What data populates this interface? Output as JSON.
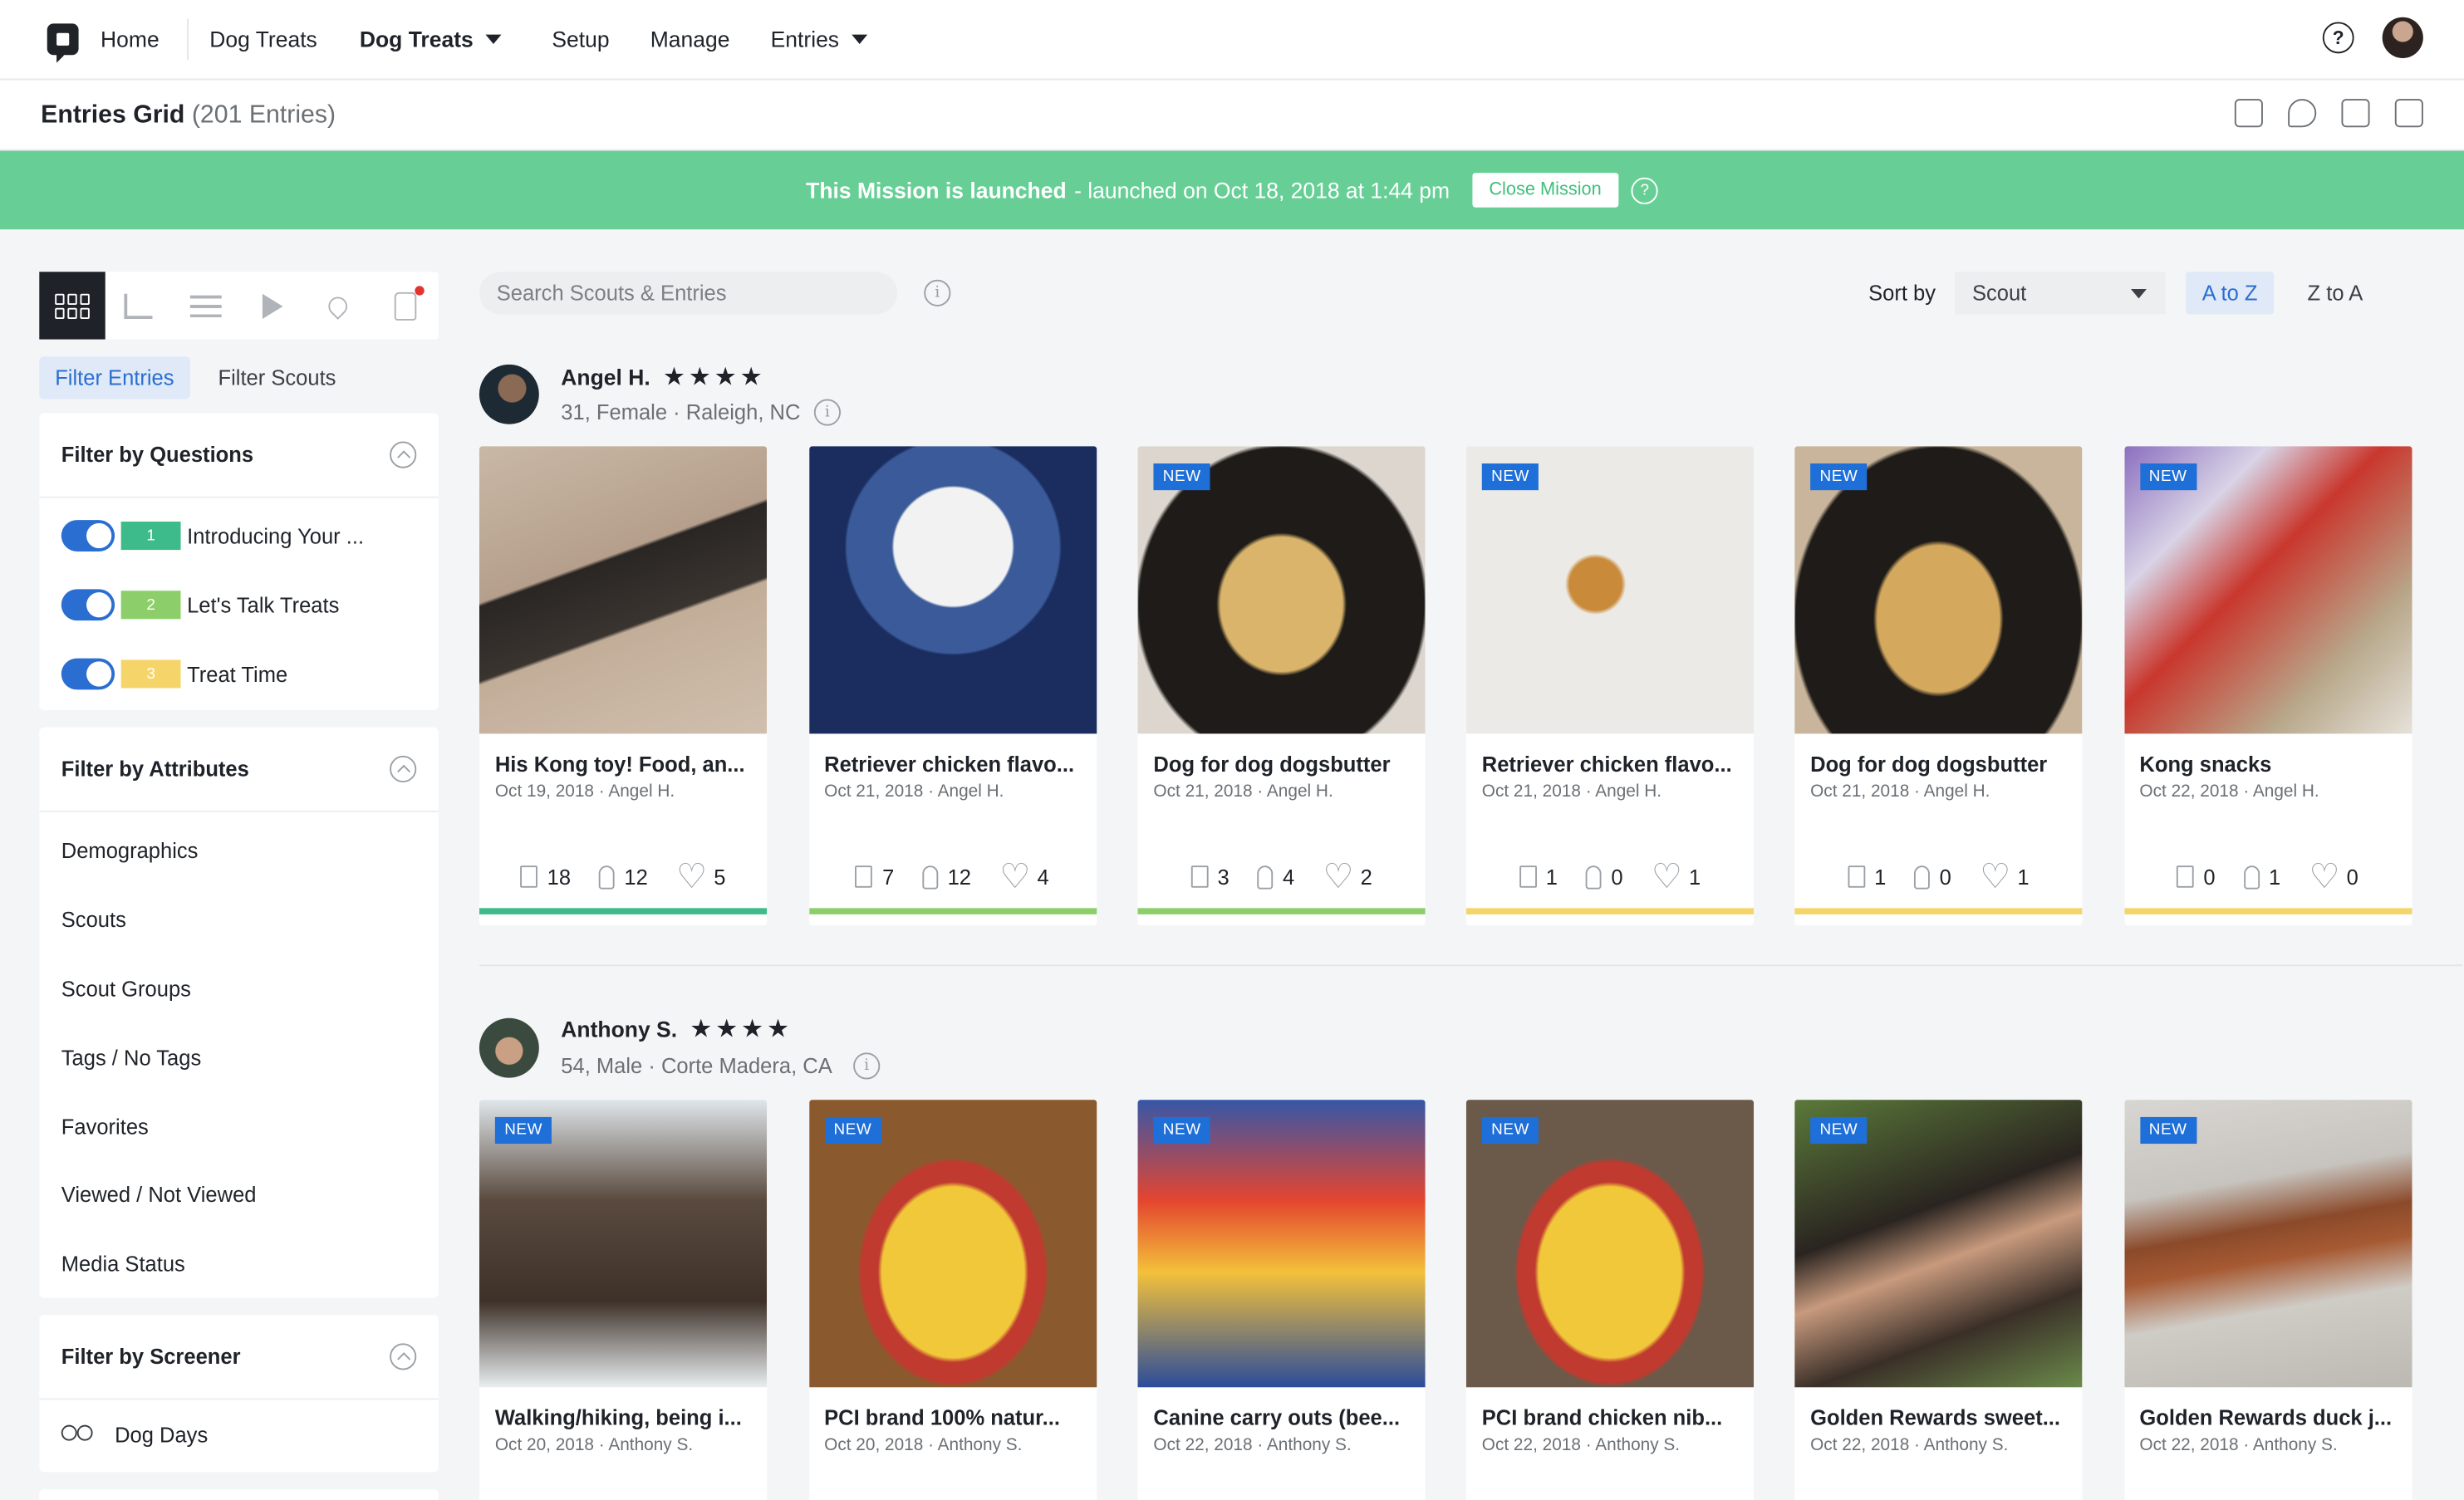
{
  "nav": {
    "home": "Home",
    "dog_treats": "Dog Treats",
    "dog_treats_bold": "Dog Treats",
    "setup": "Setup",
    "manage": "Manage",
    "entries": "Entries",
    "help": "?"
  },
  "subheader": {
    "title": "Entries Grid",
    "count": "(201 Entries)"
  },
  "banner": {
    "launched": "This Mission is launched",
    "detail": "- launched on Oct 18, 2018 at 1:44 pm",
    "close_button": "Close Mission",
    "help": "?"
  },
  "sidebar": {
    "filter_tabs": [
      "Filter Entries",
      "Filter Scouts"
    ],
    "questions": {
      "title": "Filter by Questions",
      "items": [
        {
          "num": "1",
          "label": "Introducing Your ...",
          "color": "#3dbb8a"
        },
        {
          "num": "2",
          "label": "Let's Talk Treats",
          "color": "#8ccf6a"
        },
        {
          "num": "3",
          "label": "Treat Time",
          "color": "#f5d56a"
        }
      ]
    },
    "attributes": {
      "title": "Filter by Attributes",
      "items": [
        "Demographics",
        "Scouts",
        "Scout Groups",
        "Tags / No Tags",
        "Favorites",
        "Viewed / Not Viewed",
        "Media Status"
      ]
    },
    "screener": {
      "title": "Filter by Screener",
      "items": [
        "Dog Days"
      ]
    }
  },
  "toolbar": {
    "search_placeholder": "Search Scouts & Entries",
    "sort_label": "Sort by",
    "sort_value": "Scout",
    "az": "A to Z",
    "za": "Z to A"
  },
  "scouts": [
    {
      "name": "Angel H.",
      "stars": "★★★★",
      "meta": "31, Female · Raleigh, NC",
      "cards": [
        {
          "title": "His Kong toy! Food, an...",
          "sub": "Oct 19, 2018 · Angel H.",
          "new": "",
          "docs": "18",
          "clips": "12",
          "likes": "5",
          "bar": "#3dbb8a"
        },
        {
          "title": "Retriever chicken flavo...",
          "sub": "Oct 21, 2018 · Angel H.",
          "new": "",
          "docs": "7",
          "clips": "12",
          "likes": "4",
          "bar": "#8ccf6a"
        },
        {
          "title": "Dog for dog dogsbutter",
          "sub": "Oct 21, 2018 · Angel H.",
          "new": "NEW",
          "docs": "3",
          "clips": "4",
          "likes": "2",
          "bar": "#8ccf6a"
        },
        {
          "title": "Retriever chicken flavo...",
          "sub": "Oct 21, 2018 · Angel H.",
          "new": "NEW",
          "docs": "1",
          "clips": "0",
          "likes": "1",
          "bar": "#f5d56a"
        },
        {
          "title": "Dog for dog dogsbutter",
          "sub": "Oct 21, 2018 · Angel H.",
          "new": "NEW",
          "docs": "1",
          "clips": "0",
          "likes": "1",
          "bar": "#f5d56a"
        },
        {
          "title": "Kong snacks",
          "sub": "Oct 22, 2018 · Angel H.",
          "new": "NEW",
          "docs": "0",
          "clips": "1",
          "likes": "0",
          "bar": "#f5d56a"
        }
      ]
    },
    {
      "name": "Anthony S.",
      "stars": "★★★★",
      "meta": "54, Male · Corte Madera, CA",
      "cards": [
        {
          "title": "Walking/hiking, being i...",
          "sub": "Oct 20, 2018 · Anthony S.",
          "new": "NEW"
        },
        {
          "title": "PCI brand 100% natur...",
          "sub": "Oct 20, 2018 · Anthony S.",
          "new": "NEW"
        },
        {
          "title": "Canine carry outs (bee...",
          "sub": "Oct 22, 2018 · Anthony S.",
          "new": "NEW"
        },
        {
          "title": "PCI brand chicken nib...",
          "sub": "Oct 22, 2018 · Anthony S.",
          "new": "NEW"
        },
        {
          "title": "Golden Rewards sweet...",
          "sub": "Oct 22, 2018 · Anthony S.",
          "new": "NEW"
        },
        {
          "title": "Golden Rewards duck j...",
          "sub": "Oct 22, 2018 · Anthony S.",
          "new": "NEW"
        }
      ]
    }
  ]
}
